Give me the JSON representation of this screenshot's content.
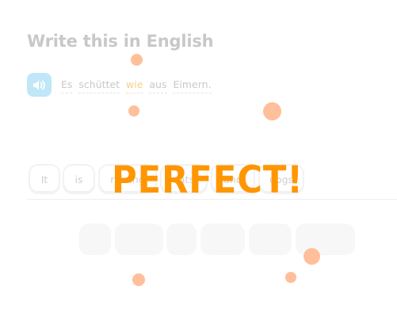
{
  "prompt": {
    "title": "Write this in English"
  },
  "audio": {
    "icon": "speaker-icon"
  },
  "sentence": {
    "words": [
      "Es",
      "schüttet",
      "wie",
      "aus",
      "Eimern."
    ],
    "highlighted_word": "wie"
  },
  "answer_words": [
    {
      "label": "It"
    },
    {
      "label": "is"
    },
    {
      "label": "raining"
    },
    {
      "label": "cats"
    },
    {
      "label": "and"
    },
    {
      "label": "dogs"
    }
  ],
  "feedback": {
    "text": "PERFECT!"
  },
  "colors": {
    "accent": "#ff9600",
    "confetti": "#ffbf9a",
    "speaker_bg": "#bfe7f7",
    "highlight": "#f7cf86"
  }
}
